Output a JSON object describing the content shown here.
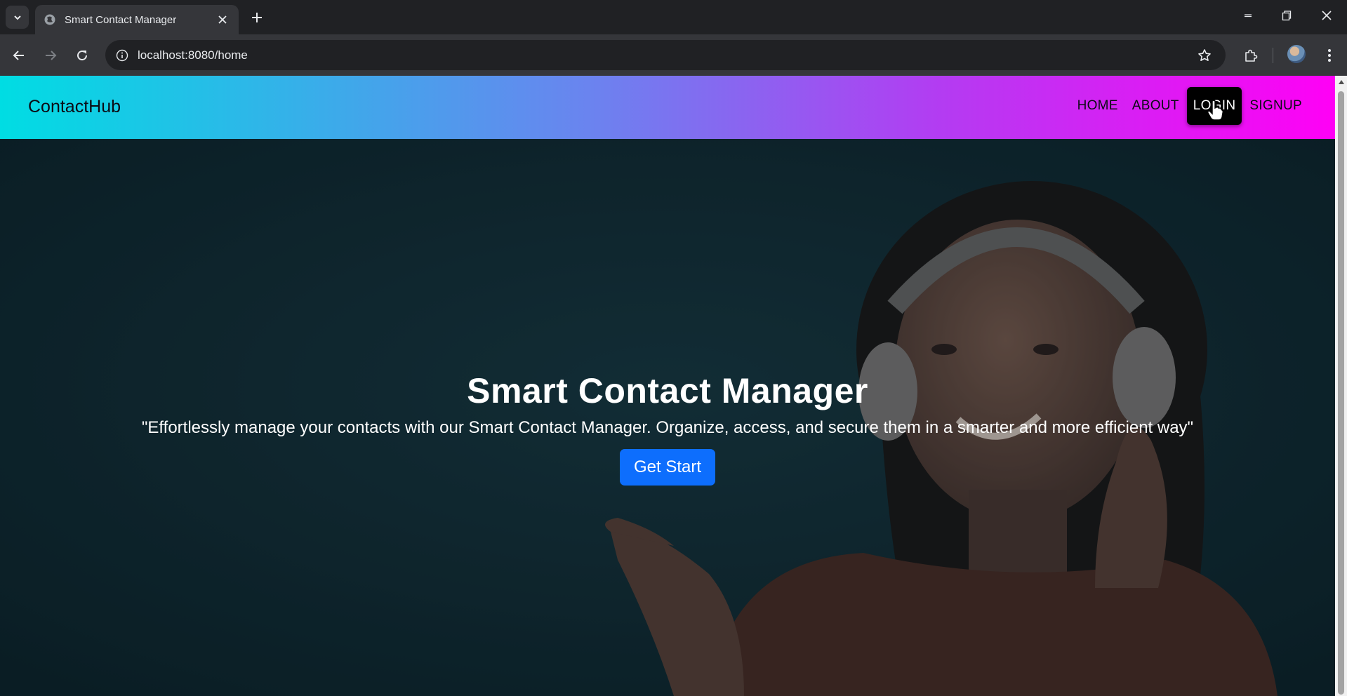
{
  "browser": {
    "tab_title": "Smart Contact Manager",
    "url": "localhost:8080/home"
  },
  "icons": {
    "tab_search": "chevron-down-icon",
    "favicon": "globe-icon",
    "tab_close": "close-icon",
    "new_tab": "plus-icon",
    "minimize": "minimize-icon",
    "restore": "restore-icon",
    "close_window": "close-icon",
    "back": "arrow-left-icon",
    "forward": "arrow-right-icon",
    "reload": "reload-icon",
    "site_info": "tune-icon",
    "bookmark": "star-icon",
    "extensions": "puzzle-icon",
    "menu": "kebab-icon"
  },
  "site": {
    "brand": "ContactHub",
    "nav": [
      {
        "label": "HOME"
      },
      {
        "label": "ABOUT"
      },
      {
        "label": "LOGIN",
        "active": true
      },
      {
        "label": "SIGNUP"
      }
    ]
  },
  "hero": {
    "title": "Smart Contact Manager",
    "subtitle": "\"Effortlessly manage your contacts with our Smart Contact Manager. Organize, access, and secure them in a smarter and more efficient way\"",
    "cta_label": "Get Start"
  },
  "colors": {
    "navbar_gradient_start": "#00dde3",
    "navbar_gradient_end": "#ff00f5",
    "cta_background": "#0d6efd",
    "active_nav_background": "#000000"
  }
}
